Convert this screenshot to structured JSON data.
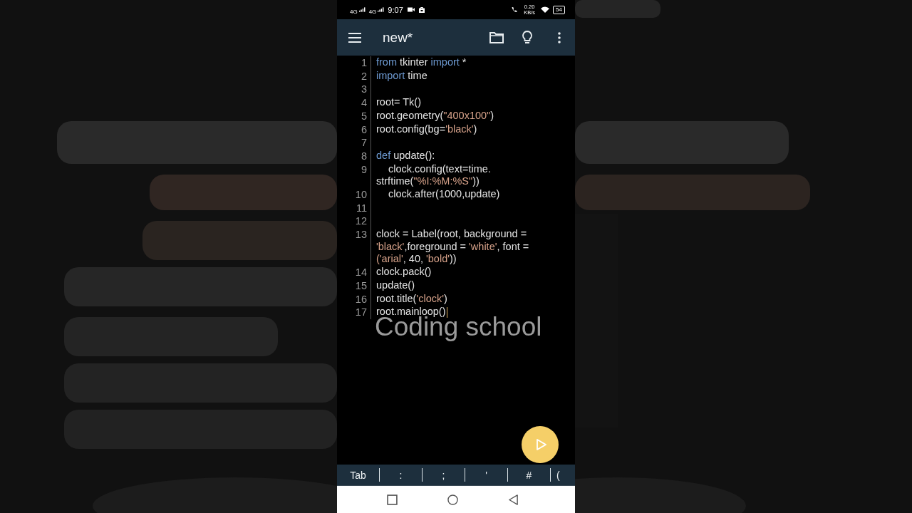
{
  "status_bar": {
    "network_left": [
      "4G",
      "4G"
    ],
    "time": "9:07",
    "speed": [
      "0.20",
      "KB/s"
    ],
    "battery": "54"
  },
  "app_bar": {
    "title": "new*"
  },
  "editor": {
    "lines": [
      {
        "number": "1",
        "rows": [
          {
            "tokens": [
              {
                "kind": "kw",
                "text": "from"
              },
              {
                "kind": "plain",
                "text": " tkinter "
              },
              {
                "kind": "kw",
                "text": "import"
              },
              {
                "kind": "plain",
                "text": " *"
              }
            ]
          }
        ]
      },
      {
        "number": "2",
        "rows": [
          {
            "tokens": [
              {
                "kind": "kw",
                "text": "import"
              },
              {
                "kind": "plain",
                "text": " time"
              }
            ]
          }
        ]
      },
      {
        "number": "3",
        "rows": [
          {
            "tokens": []
          }
        ]
      },
      {
        "number": "4",
        "rows": [
          {
            "tokens": [
              {
                "kind": "plain",
                "text": "root= Tk()"
              }
            ]
          }
        ]
      },
      {
        "number": "5",
        "rows": [
          {
            "tokens": [
              {
                "kind": "plain",
                "text": "root.geometry("
              },
              {
                "kind": "str",
                "text": "\"400x100\""
              },
              {
                "kind": "plain",
                "text": ")"
              }
            ]
          }
        ]
      },
      {
        "number": "6",
        "rows": [
          {
            "tokens": [
              {
                "kind": "plain",
                "text": "root.config(bg="
              },
              {
                "kind": "str",
                "text": "'black'"
              },
              {
                "kind": "plain",
                "text": ")"
              }
            ]
          }
        ]
      },
      {
        "number": "7",
        "rows": [
          {
            "tokens": []
          }
        ]
      },
      {
        "number": "8",
        "rows": [
          {
            "tokens": [
              {
                "kind": "kw",
                "text": "def"
              },
              {
                "kind": "plain",
                "text": " update():"
              }
            ]
          }
        ]
      },
      {
        "number": "9",
        "indent": true,
        "rows": [
          {
            "tokens": [
              {
                "kind": "plain",
                "text": "clock.config(text=time."
              }
            ]
          },
          {
            "tokens": [
              {
                "kind": "plain",
                "text": "strftime("
              },
              {
                "kind": "str",
                "text": "\"%I:%M:%S\""
              },
              {
                "kind": "plain",
                "text": "))"
              }
            ]
          }
        ]
      },
      {
        "number": "10",
        "indent": true,
        "rows": [
          {
            "tokens": [
              {
                "kind": "plain",
                "text": "clock.after(1000,update)"
              }
            ]
          }
        ]
      },
      {
        "number": "11",
        "rows": [
          {
            "tokens": []
          }
        ]
      },
      {
        "number": "12",
        "rows": [
          {
            "tokens": []
          }
        ]
      },
      {
        "number": "13",
        "rows": [
          {
            "tokens": [
              {
                "kind": "plain",
                "text": "clock = Label(root, background ="
              }
            ]
          },
          {
            "tokens": [
              {
                "kind": "str",
                "text": "'black'"
              },
              {
                "kind": "plain",
                "text": ",foreground = "
              },
              {
                "kind": "str",
                "text": "'white'"
              },
              {
                "kind": "plain",
                "text": ", font ="
              }
            ]
          },
          {
            "tokens": [
              {
                "kind": "str",
                "text": "('arial'"
              },
              {
                "kind": "plain",
                "text": ", 40, "
              },
              {
                "kind": "str",
                "text": "'bold'"
              },
              {
                "kind": "plain",
                "text": "))"
              }
            ]
          }
        ]
      },
      {
        "number": "14",
        "rows": [
          {
            "tokens": [
              {
                "kind": "plain",
                "text": "clock.pack()"
              }
            ]
          }
        ]
      },
      {
        "number": "15",
        "rows": [
          {
            "tokens": [
              {
                "kind": "plain",
                "text": "update()"
              }
            ]
          }
        ]
      },
      {
        "number": "16",
        "rows": [
          {
            "tokens": [
              {
                "kind": "plain",
                "text": "root.title("
              },
              {
                "kind": "str",
                "text": "'clock'"
              },
              {
                "kind": "plain",
                "text": ")"
              }
            ]
          }
        ]
      },
      {
        "number": "17",
        "cursor": true,
        "rows": [
          {
            "tokens": [
              {
                "kind": "plain",
                "text": "root.mainloop()"
              }
            ]
          }
        ]
      }
    ]
  },
  "overlay_text": "Coding school",
  "key_bar": {
    "keys": [
      "Tab",
      ":",
      ";",
      "'",
      "#",
      "("
    ]
  }
}
